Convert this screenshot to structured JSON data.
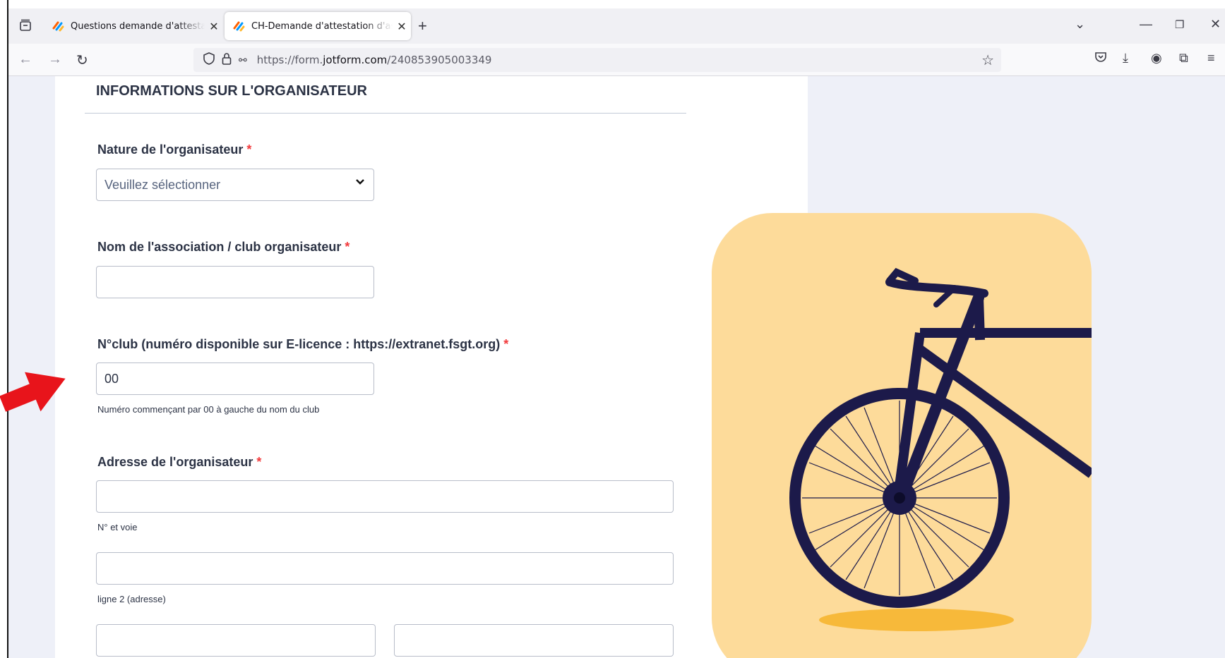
{
  "browser": {
    "tabs": [
      {
        "title": "Questions demande d'attestation",
        "active": false
      },
      {
        "title": "CH-Demande d'attestation d'assurance",
        "active": true
      }
    ],
    "url_prefix": "https://form.",
    "url_domain": "jotform.com",
    "url_path": "/240853905003349",
    "icons": [
      "tab-list-icon",
      "back-icon",
      "forward-icon",
      "reload-icon",
      "shield-icon",
      "lock-icon",
      "permissions-icon",
      "star-icon",
      "pocket-icon",
      "download-icon",
      "account-icon",
      "extensions-icon",
      "menu-icon",
      "chevron-down-icon",
      "minimize-icon",
      "restore-icon",
      "close-icon"
    ]
  },
  "form": {
    "section_title": "INFORMATIONS SUR L'ORGANISATEUR",
    "nature": {
      "label": "Nature de l'organisateur",
      "placeholder": "Veuillez sélectionner"
    },
    "association": {
      "label": "Nom de l'association / club organisateur",
      "value": ""
    },
    "club_number": {
      "label": "N°club (numéro disponible sur E-licence : https://extranet.fsgt.org)",
      "value": "00",
      "help": "Numéro commençant par 00 à gauche du nom du club"
    },
    "address": {
      "label": "Adresse de l'organisateur",
      "line1_sublabel": "N° et voie",
      "line2_sublabel": "ligne 2 (adresse)"
    },
    "required_mark": "*"
  },
  "colors": {
    "accent_required": "#f23a3c",
    "illustration_bg": "#fddb9a",
    "bike": "#1c1a4a",
    "arrow": "#e8141b"
  }
}
